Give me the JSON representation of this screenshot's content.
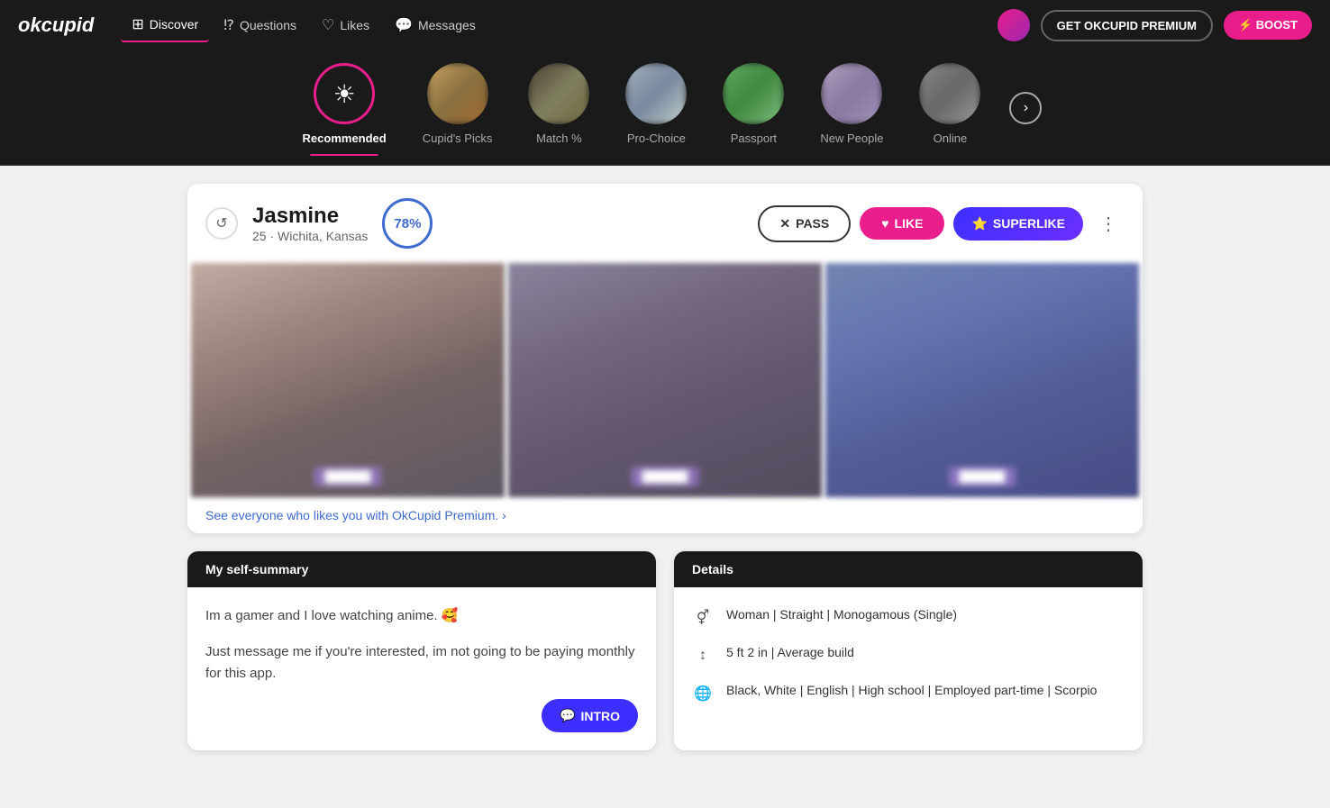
{
  "logo": "okcupid",
  "nav": {
    "items": [
      {
        "id": "discover",
        "label": "Discover",
        "icon": "⊞",
        "active": true
      },
      {
        "id": "questions",
        "label": "Questions",
        "icon": "❓"
      },
      {
        "id": "likes",
        "label": "Likes",
        "icon": "♡"
      },
      {
        "id": "messages",
        "label": "Messages",
        "icon": "💬"
      }
    ]
  },
  "header_buttons": {
    "premium_label": "GET OKCUPID PREMIUM",
    "boost_label": "⚡ BOOST"
  },
  "categories": [
    {
      "id": "recommended",
      "label": "Recommended",
      "active": true,
      "type": "icon"
    },
    {
      "id": "cupids-picks",
      "label": "Cupid's Picks",
      "active": false,
      "type": "photo"
    },
    {
      "id": "match",
      "label": "Match %",
      "active": false,
      "type": "photo"
    },
    {
      "id": "pro-choice",
      "label": "Pro-Choice",
      "active": false,
      "type": "photo"
    },
    {
      "id": "passport",
      "label": "Passport",
      "active": false,
      "type": "photo"
    },
    {
      "id": "new-people",
      "label": "New People",
      "active": false,
      "type": "photo"
    },
    {
      "id": "online",
      "label": "Online",
      "active": false,
      "type": "photo"
    }
  ],
  "profile": {
    "name": "Jasmine",
    "age": "25",
    "location": "Wichita, Kansas",
    "match_percent": "78%",
    "pass_label": "PASS",
    "like_label": "LIKE",
    "superlike_label": "SUPERLIKE",
    "likes_promo": "See everyone who likes you with OkCupid Premium. ›",
    "photos": [
      {
        "badge": "██████"
      },
      {
        "badge": "██████"
      },
      {
        "badge": "██████"
      }
    ]
  },
  "bio": {
    "section_title": "My self-summary",
    "text1": "Im a gamer and I love watching anime. 🥰",
    "text2": "Just message me if you're interested, im not going to be paying monthly for this app.",
    "intro_label": "INTRO"
  },
  "details": {
    "section_title": "Details",
    "items": [
      {
        "icon": "♀",
        "text": "Woman | Straight | Monogamous (Single)"
      },
      {
        "icon": "↕",
        "text": "5 ft 2 in | Average build"
      },
      {
        "icon": "🌐",
        "text": "Black, White | English | High school | Employed part-time | Scorpio"
      }
    ]
  }
}
